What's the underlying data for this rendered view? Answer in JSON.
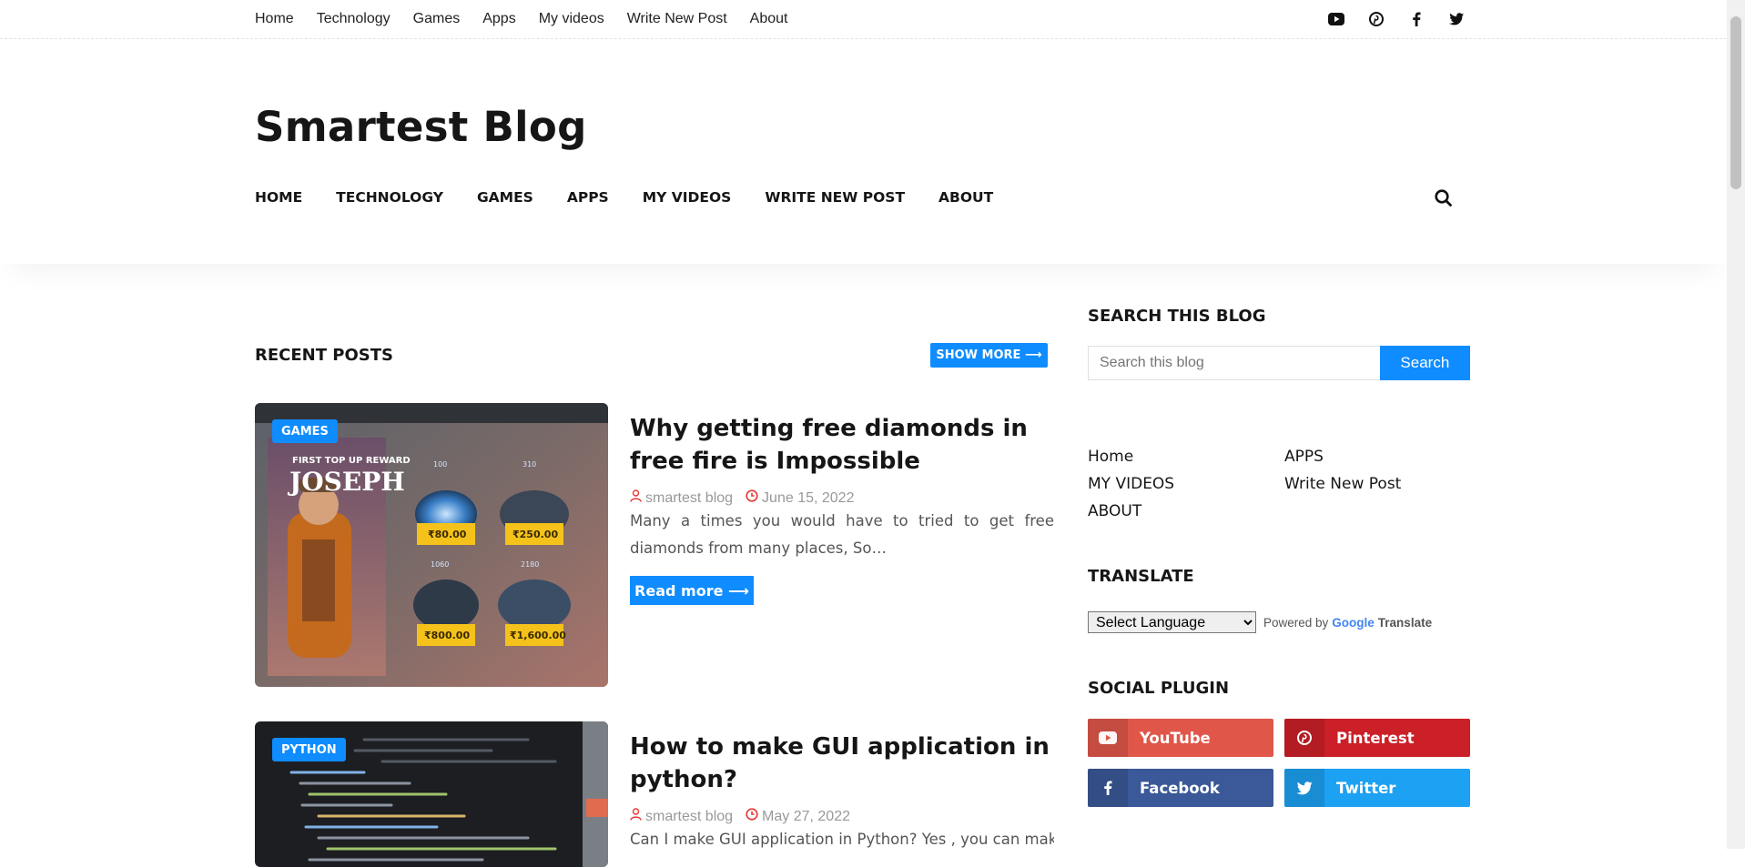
{
  "topbar": {
    "menu": [
      "Home",
      "Technology",
      "Games",
      "Apps",
      "My videos",
      "Write New Post",
      "About"
    ],
    "social_icons": [
      "youtube-icon",
      "pinterest-icon",
      "facebook-icon",
      "twitter-icon"
    ]
  },
  "header": {
    "logo": "Smartest Blog",
    "nav": [
      "HOME",
      "TECHNOLOGY",
      "GAMES",
      "APPS",
      "MY VIDEOS",
      "WRITE NEW POST",
      "ABOUT"
    ]
  },
  "recent": {
    "title": "RECENT POSTS",
    "show_more": "SHOW MORE ⟶"
  },
  "posts": [
    {
      "category": "GAMES",
      "title": "Why getting free diamonds in free fire is Impossible",
      "author": "smartest blog",
      "date": "June 15, 2022",
      "excerpt": "Many a times you would have to tried to get free diamonds from many places, So…",
      "read_more": "Read more ⟶",
      "thumb": {
        "banner": "FIRST TOP UP REWARD",
        "name": "JOSEPH",
        "prices": [
          "₹80.00",
          "₹250.00",
          "₹800.00",
          "₹1,600.00"
        ],
        "counts": [
          "100",
          "310",
          "1060",
          "2180"
        ]
      }
    },
    {
      "category": "PYTHON",
      "title": "How to make GUI application in python?",
      "author": "smartest blog",
      "date": "May 27, 2022",
      "excerpt": "Can I make GUI application in Python? Yes , you can make a"
    }
  ],
  "sidebar": {
    "search_title": "SEARCH THIS BLOG",
    "search_placeholder": "Search this blog",
    "search_button": "Search",
    "pages": [
      "Home",
      "APPS",
      "MY VIDEOS",
      "Write New Post",
      "ABOUT"
    ],
    "translate_title": "TRANSLATE",
    "language_select": "Select Language",
    "powered_by": "Powered by",
    "google": "Google",
    "translate_word": "Translate",
    "social_title": "SOCIAL PLUGIN",
    "social": [
      {
        "label": "YouTube",
        "icon": "youtube-icon",
        "color": "#e0574a"
      },
      {
        "label": "Pinterest",
        "icon": "pinterest-icon",
        "color": "#cb2027"
      },
      {
        "label": "Facebook",
        "icon": "facebook-icon",
        "color": "#3b5998"
      },
      {
        "label": "Twitter",
        "icon": "twitter-icon",
        "color": "#1da1f2"
      }
    ]
  },
  "colors": {
    "accent": "#0f8cff",
    "text": "#161616",
    "meta_icon": "#e53935"
  }
}
